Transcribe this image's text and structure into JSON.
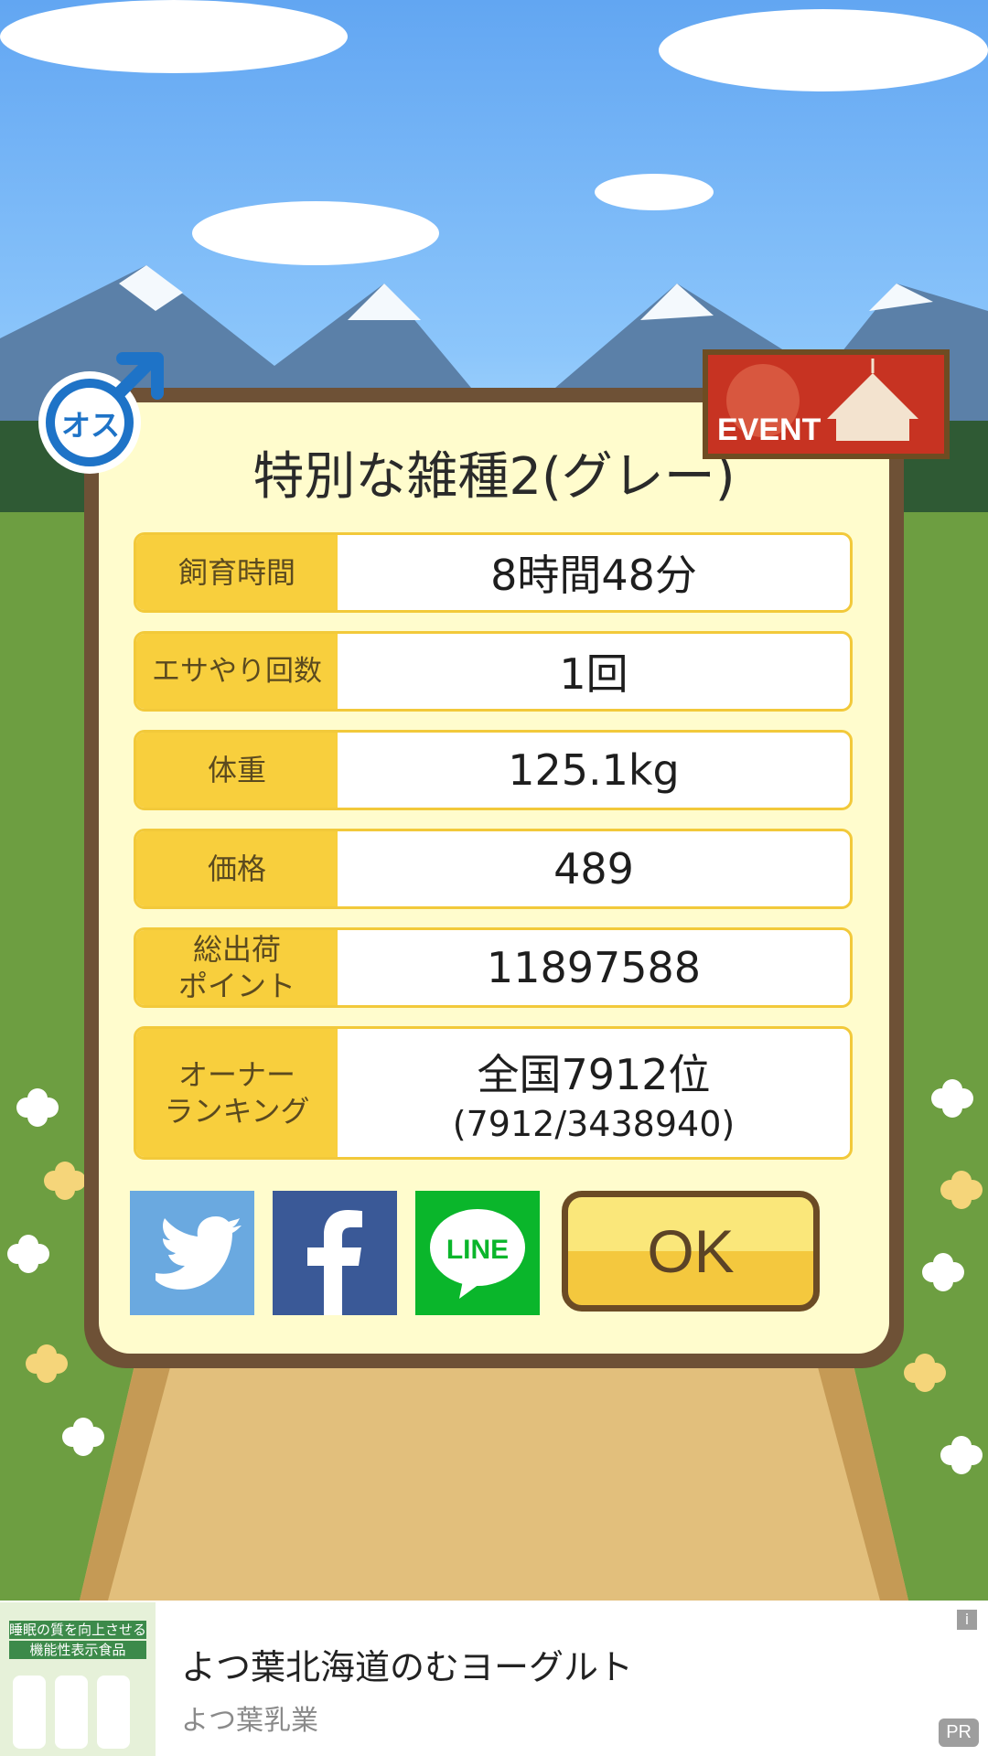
{
  "dialog": {
    "title": "特別な雑種2(グレー)",
    "rows": [
      {
        "label": "飼育時間",
        "value": "8時間48分"
      },
      {
        "label": "エサやり回数",
        "value": "1回"
      },
      {
        "label": "体重",
        "value": "125.1kg"
      },
      {
        "label": "価格",
        "value": "489"
      },
      {
        "label": "総出荷\nポイント",
        "value": "11897588"
      },
      {
        "label": "オーナー\nランキング",
        "value": "全国7912位",
        "sub": "(7912/3438940)"
      }
    ],
    "ok_label": "OK",
    "line_label": "LINE"
  },
  "badges": {
    "gender": "オス",
    "event": "EVENT"
  },
  "ad": {
    "title": "よつ葉北海道のむヨーグルト",
    "advertiser": "よつ葉乳業",
    "pr": "PR",
    "info": "i",
    "image_text": [
      "睡眠の質を向上させる",
      "機能性表示食品"
    ]
  },
  "colors": {
    "sky": "#62a6f2",
    "grass": "#6d9e41",
    "panel_border": "#6e5136",
    "panel_fill": "#fffccd",
    "label_yellow": "#f8cf3d",
    "twitter": "#6aa9e0",
    "facebook": "#3a5997",
    "line": "#0ab62b",
    "event_red": "#c73322"
  }
}
